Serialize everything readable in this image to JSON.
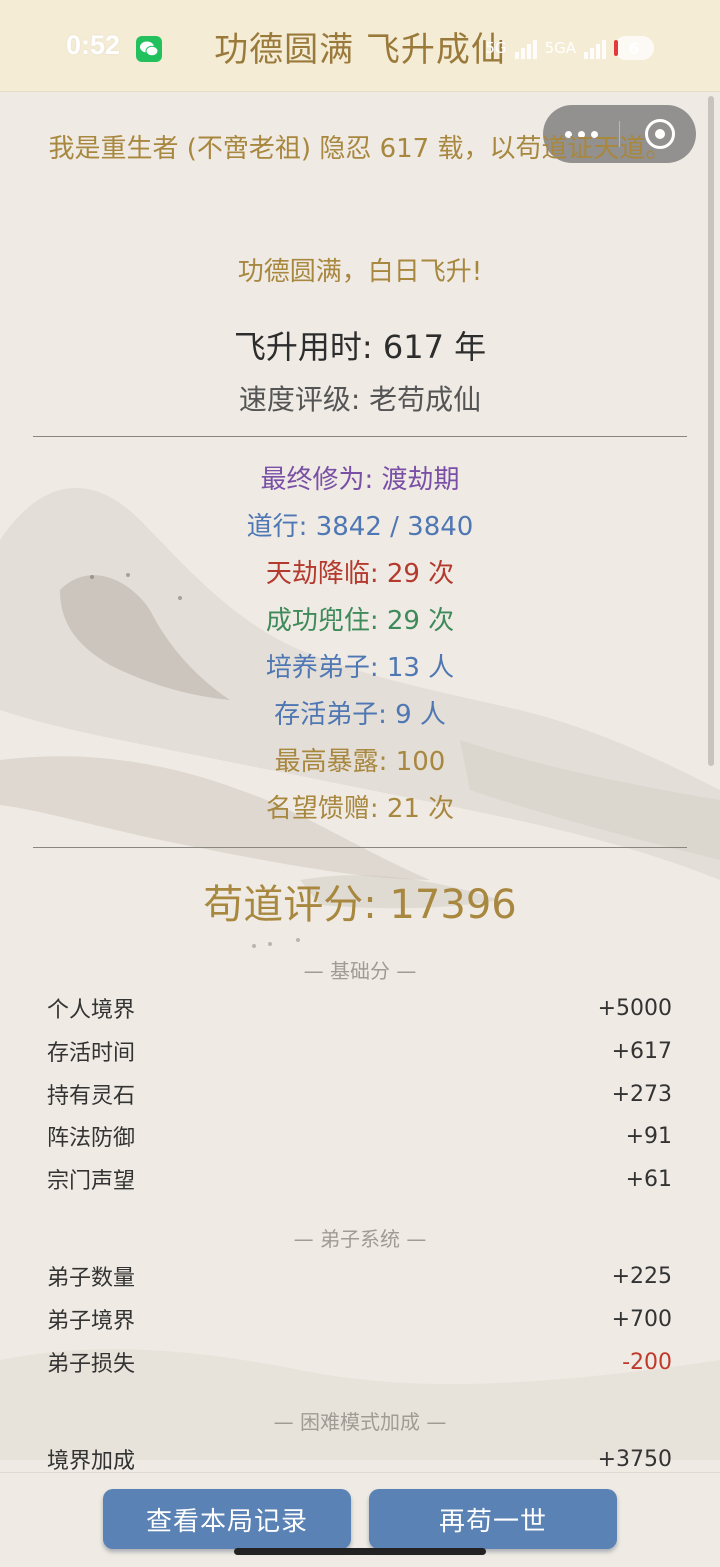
{
  "status": {
    "time": "0:52",
    "network1": "5G",
    "network2": "5GA",
    "battery": "6"
  },
  "header": {
    "title": "功德圆满 飞升成仙"
  },
  "intro": {
    "line": "我是重生者 (不啻老祖) 隐忍 617 载，以苟道证天道。",
    "line2": "功德圆满，白日飞升!"
  },
  "ascend_time": "飞升用时: 617 年",
  "speed_rating": "速度评级: 老苟成仙",
  "stats": [
    {
      "text": "最终修为: 渡劫期",
      "color": "#7a4fa6"
    },
    {
      "text": "道行: 3842 / 3840",
      "color": "#4f77b3"
    },
    {
      "text": "天劫降临: 29 次",
      "color": "#b43a2e"
    },
    {
      "text": "成功兜住: 29 次",
      "color": "#3f8a5a"
    },
    {
      "text": "培养弟子: 13 人",
      "color": "#4f77b3"
    },
    {
      "text": "存活弟子: 9 人",
      "color": "#4f77b3"
    },
    {
      "text": "最高暴露: 100",
      "color": "#a8873f"
    },
    {
      "text": "名望馈赠: 21 次",
      "color": "#a8873f"
    }
  ],
  "score": {
    "title": "苟道评分: 17396"
  },
  "sections": {
    "base": "— 基础分 —",
    "disciples": "— 弟子系统 —",
    "hard": "— 困难模式加成 —"
  },
  "base_rows": [
    {
      "label": "个人境界",
      "value": "+5000"
    },
    {
      "label": "存活时间",
      "value": "+617"
    },
    {
      "label": "持有灵石",
      "value": "+273"
    },
    {
      "label": "阵法防御",
      "value": "+91"
    },
    {
      "label": "宗门声望",
      "value": "+61"
    }
  ],
  "disciple_rows": [
    {
      "label": "弟子数量",
      "value": "+225"
    },
    {
      "label": "弟子境界",
      "value": "+700"
    },
    {
      "label": "弟子损失",
      "value": "-200"
    }
  ],
  "hard_rows": [
    {
      "label": "境界加成",
      "value": "+3750"
    }
  ],
  "buttons": {
    "view_record": "查看本局记录",
    "again": "再苟一世"
  },
  "colors": {
    "accent": "#a8873f",
    "button": "#5a82b4",
    "negative": "#c0392b",
    "wechat": "#22c15e"
  }
}
